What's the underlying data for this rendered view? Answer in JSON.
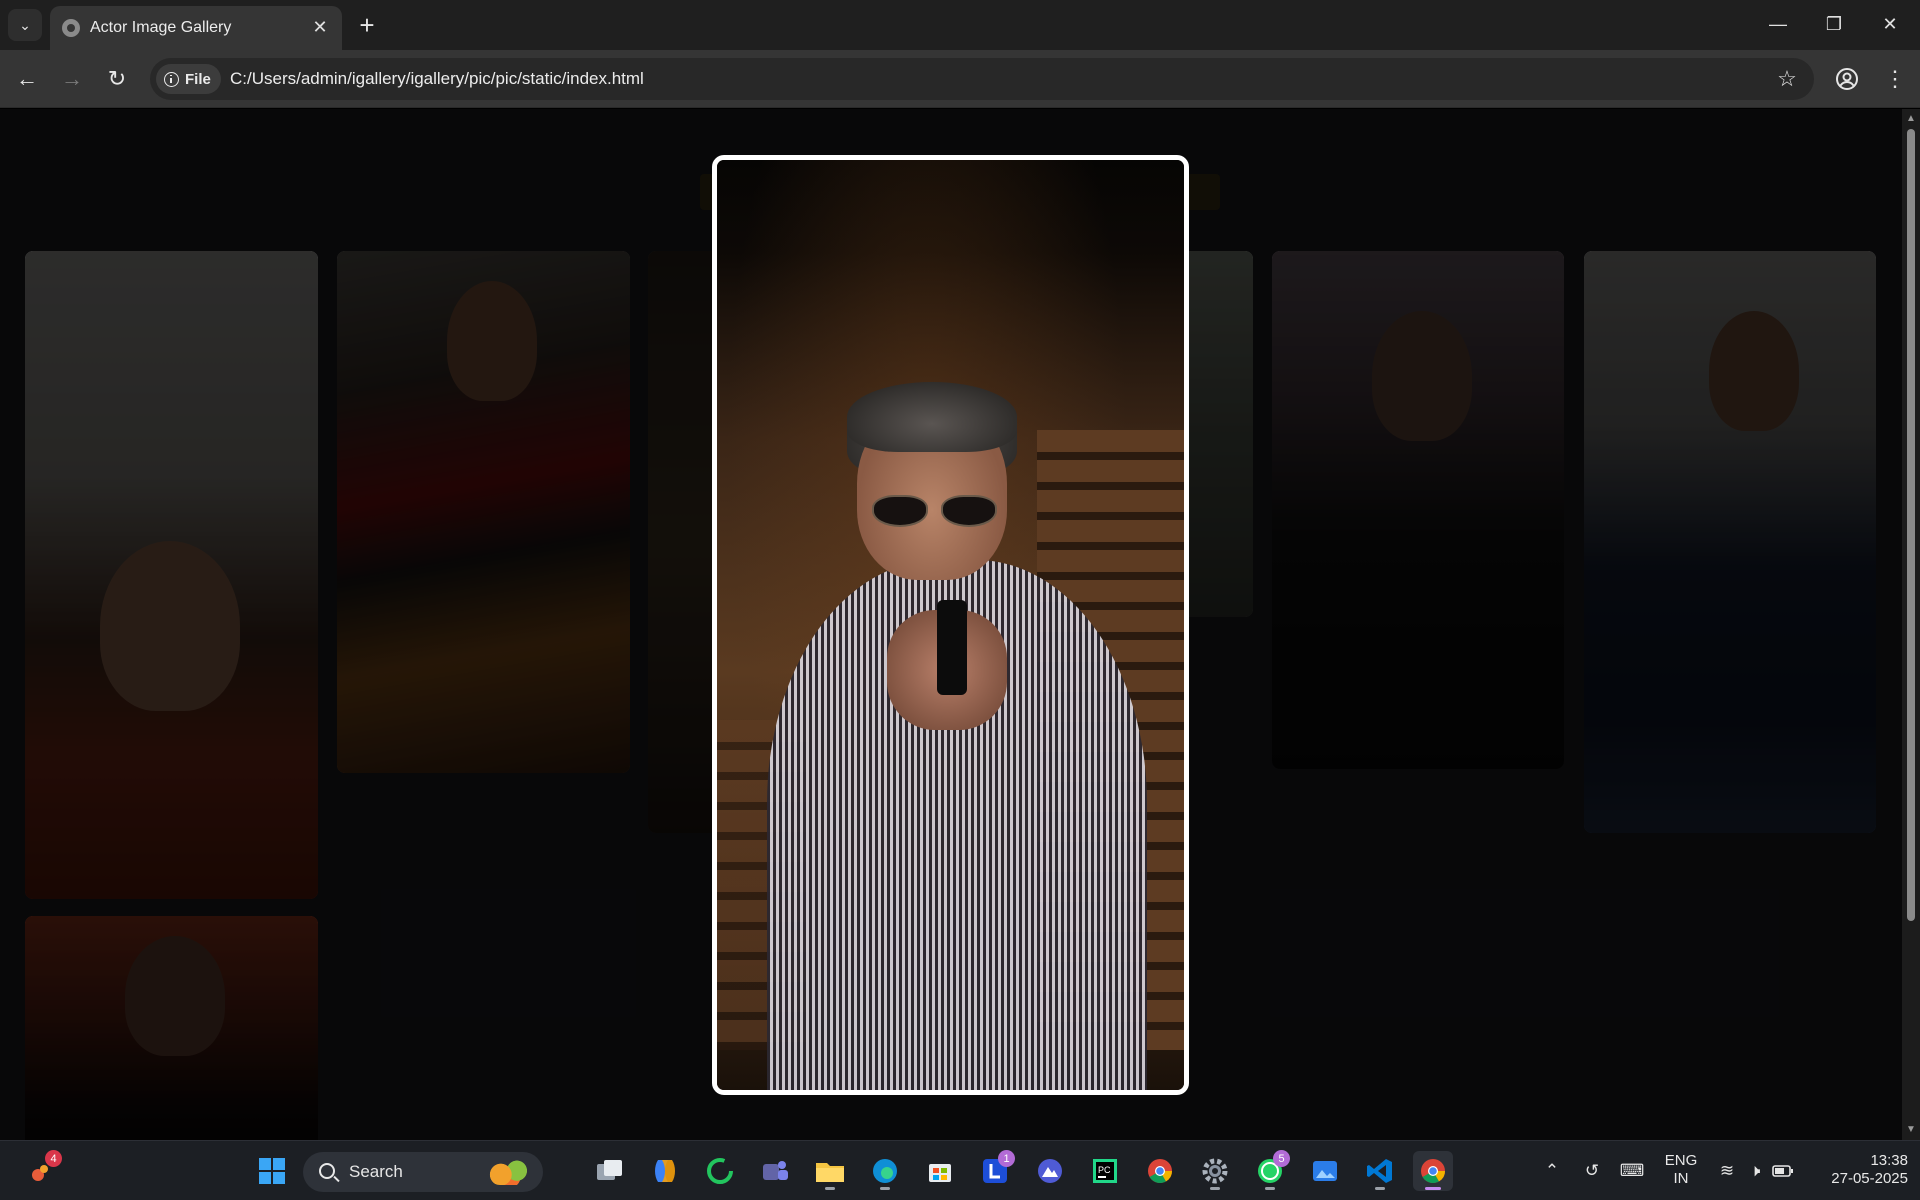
{
  "browser": {
    "tab_title": "Actor Image Gallery",
    "chip_label": "File",
    "url": "C:/Users/admin/igallery/igallery/pic/pic/static/index.html"
  },
  "gallery": {
    "modal_open": true,
    "cards": [
      {
        "subject": "smiling man in red sweater"
      },
      {
        "subject": "man with acoustic guitar in red striped shirt"
      },
      {
        "subject": "partially hidden photo"
      },
      {
        "subject": "partially hidden photo"
      },
      {
        "subject": "bearded man in black suit, seated"
      },
      {
        "subject": "man in navy shirt, outdoors"
      },
      {
        "subject": "curly-haired man in black shirt"
      }
    ],
    "modal_image": {
      "subject": "man in sunglasses and striped shirt aiming a pistol"
    }
  },
  "taskbar": {
    "search_label": "Search",
    "notification_badge": "4",
    "apps": [
      {
        "name": "start",
        "icon": "windows-icon"
      },
      {
        "name": "task-view",
        "icon": "task-view-icon"
      },
      {
        "name": "copilot",
        "icon": "copilot-icon"
      },
      {
        "name": "refresh-app",
        "icon": "green-circle-icon"
      },
      {
        "name": "teams",
        "icon": "teams-icon"
      },
      {
        "name": "file-explorer",
        "icon": "folder-icon"
      },
      {
        "name": "edge",
        "icon": "edge-icon"
      },
      {
        "name": "store",
        "icon": "store-icon"
      },
      {
        "name": "l-app",
        "icon": "l-app-icon",
        "badge": "1"
      },
      {
        "name": "arc-app",
        "icon": "mountain-icon"
      },
      {
        "name": "pycharm",
        "icon": "pycharm-icon"
      },
      {
        "name": "chrome",
        "icon": "chrome-icon"
      },
      {
        "name": "settings",
        "icon": "gear-icon"
      },
      {
        "name": "whatsapp",
        "icon": "whatsapp-icon",
        "badge": "5"
      },
      {
        "name": "photos",
        "icon": "photos-icon"
      },
      {
        "name": "vscode",
        "icon": "vscode-icon"
      },
      {
        "name": "chrome-active",
        "icon": "chrome-icon"
      }
    ],
    "lang_line1": "ENG",
    "lang_line2": "IN",
    "time": "13:38",
    "date": "27-05-2025"
  }
}
